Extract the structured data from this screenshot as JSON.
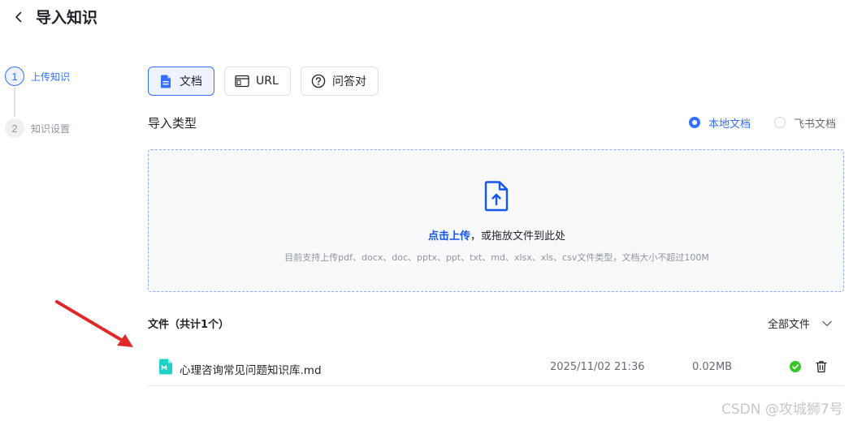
{
  "header": {
    "back_icon": "chevron-left-icon",
    "title": "导入知识"
  },
  "steps": [
    {
      "number": "1",
      "label": "上传知识",
      "state": "active"
    },
    {
      "number": "2",
      "label": "知识设置",
      "state": "inactive"
    }
  ],
  "source_tabs": [
    {
      "label": "文档",
      "icon": "document-icon",
      "selected": true
    },
    {
      "label": "URL",
      "icon": "browser-window-icon",
      "selected": false
    },
    {
      "label": "问答对",
      "icon": "question-circle-icon",
      "selected": false
    }
  ],
  "import_type": {
    "label": "导入类型",
    "options": [
      {
        "label": "本地文档",
        "checked": true
      },
      {
        "label": "飞书文档",
        "checked": false
      }
    ]
  },
  "upload": {
    "icon": "file-upload-icon",
    "link_text": "点击上传",
    "rest_text": "，或拖放文件到此处",
    "hint": "目前支持上传pdf、docx、doc、pptx、ppt、txt、md、xlsx、xls、csv文件类型，文档大小不超过100M"
  },
  "files": {
    "header": "文件（共计1个）",
    "filter_label": "全部文件",
    "items": [
      {
        "name": "心理咨询常见问题知识库.md",
        "date": "2025/11/02 21:36",
        "size": "0.02MB",
        "status": "success",
        "file_icon": "markdown-file-icon",
        "status_icon": "check-circle-icon",
        "action_icon": "trash-icon"
      }
    ]
  },
  "colors": {
    "accent": "#3370ff",
    "link": "#1456f0",
    "success": "#34c724",
    "md_icon": "#1fd1c4",
    "annotation_arrow": "#e02a2a"
  },
  "watermark": "CSDN @攻城狮7号"
}
